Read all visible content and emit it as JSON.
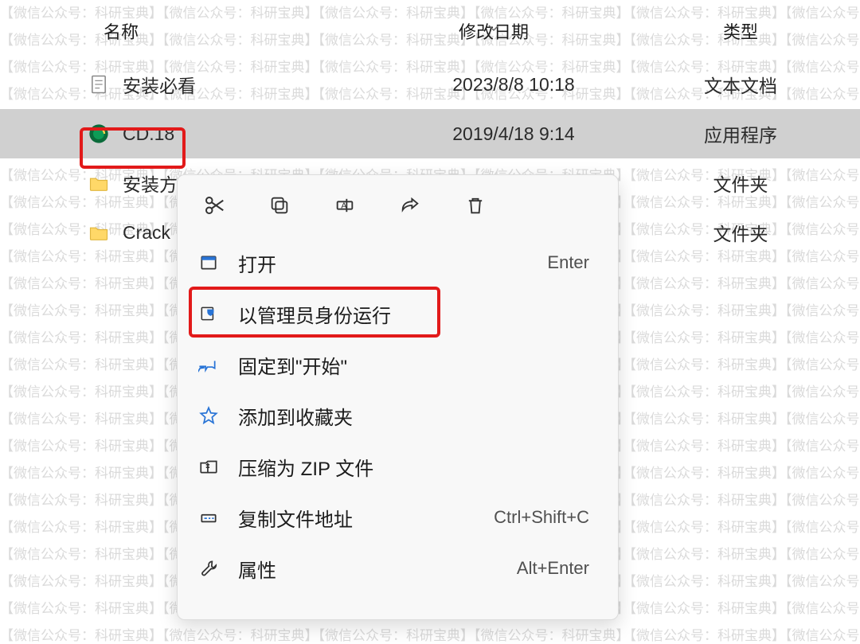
{
  "watermark_text": "【微信公众号：科研宝典】",
  "columns": {
    "name": "名称",
    "date": "修改日期",
    "type": "类型"
  },
  "files": [
    {
      "name": "安装必看",
      "date": "2023/8/8 10:18",
      "type": "文本文档",
      "icon": "text"
    },
    {
      "name": "CD.18",
      "date": "2019/4/18 9:14",
      "type": "应用程序",
      "icon": "exe",
      "selected": true
    },
    {
      "name": "安装方",
      "date": "",
      "type": "文件夹",
      "icon": "folder"
    },
    {
      "name": "Crack",
      "date": "",
      "type": "文件夹",
      "icon": "folder"
    }
  ],
  "quick_actions": {
    "cut": "cut-icon",
    "copy": "copy-icon",
    "rename": "rename-icon",
    "share": "share-icon",
    "delete": "delete-icon"
  },
  "menu": {
    "open": {
      "label": "打开",
      "shortcut": "Enter"
    },
    "run_admin": {
      "label": "以管理员身份运行",
      "shortcut": ""
    },
    "pin_start": {
      "label": "固定到\"开始\"",
      "shortcut": ""
    },
    "add_fav": {
      "label": "添加到收藏夹",
      "shortcut": ""
    },
    "zip": {
      "label": "压缩为 ZIP 文件",
      "shortcut": ""
    },
    "copy_path": {
      "label": "复制文件地址",
      "shortcut": "Ctrl+Shift+C"
    },
    "properties": {
      "label": "属性",
      "shortcut": "Alt+Enter"
    }
  }
}
